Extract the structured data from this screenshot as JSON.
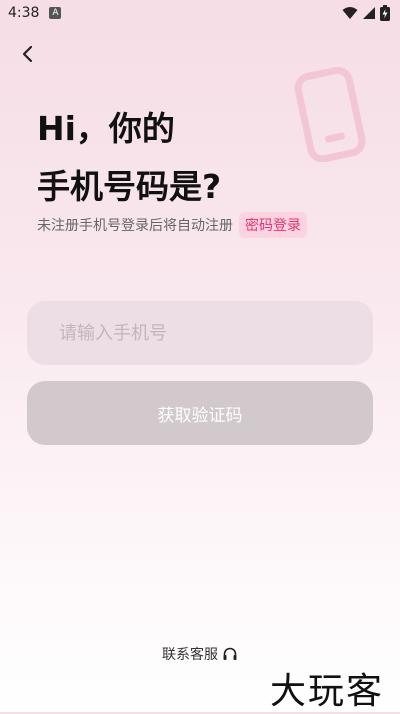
{
  "status_bar": {
    "time": "4:38",
    "notification_badge": "A",
    "icons": [
      "wifi-icon",
      "signal-icon",
      "battery-icon"
    ]
  },
  "header": {
    "back_icon": "chevron-left-icon"
  },
  "title": {
    "line1": "Hi，你的",
    "line2": "手机号码是?"
  },
  "subtitle": {
    "text": "未注册手机号登录后将自动注册",
    "password_login_label": "密码登录"
  },
  "form": {
    "phone_placeholder": "请输入手机号",
    "phone_value": "",
    "get_code_label": "获取验证码"
  },
  "footer": {
    "support_label": "联系客服",
    "support_icon": "headset-icon"
  },
  "watermark": {
    "text": "大玩客"
  },
  "colors": {
    "accent": "#e73377",
    "accent_bg": "#fbd3e1",
    "button_disabled": "#d2c9cc",
    "input_bg": "#ebdce2"
  }
}
